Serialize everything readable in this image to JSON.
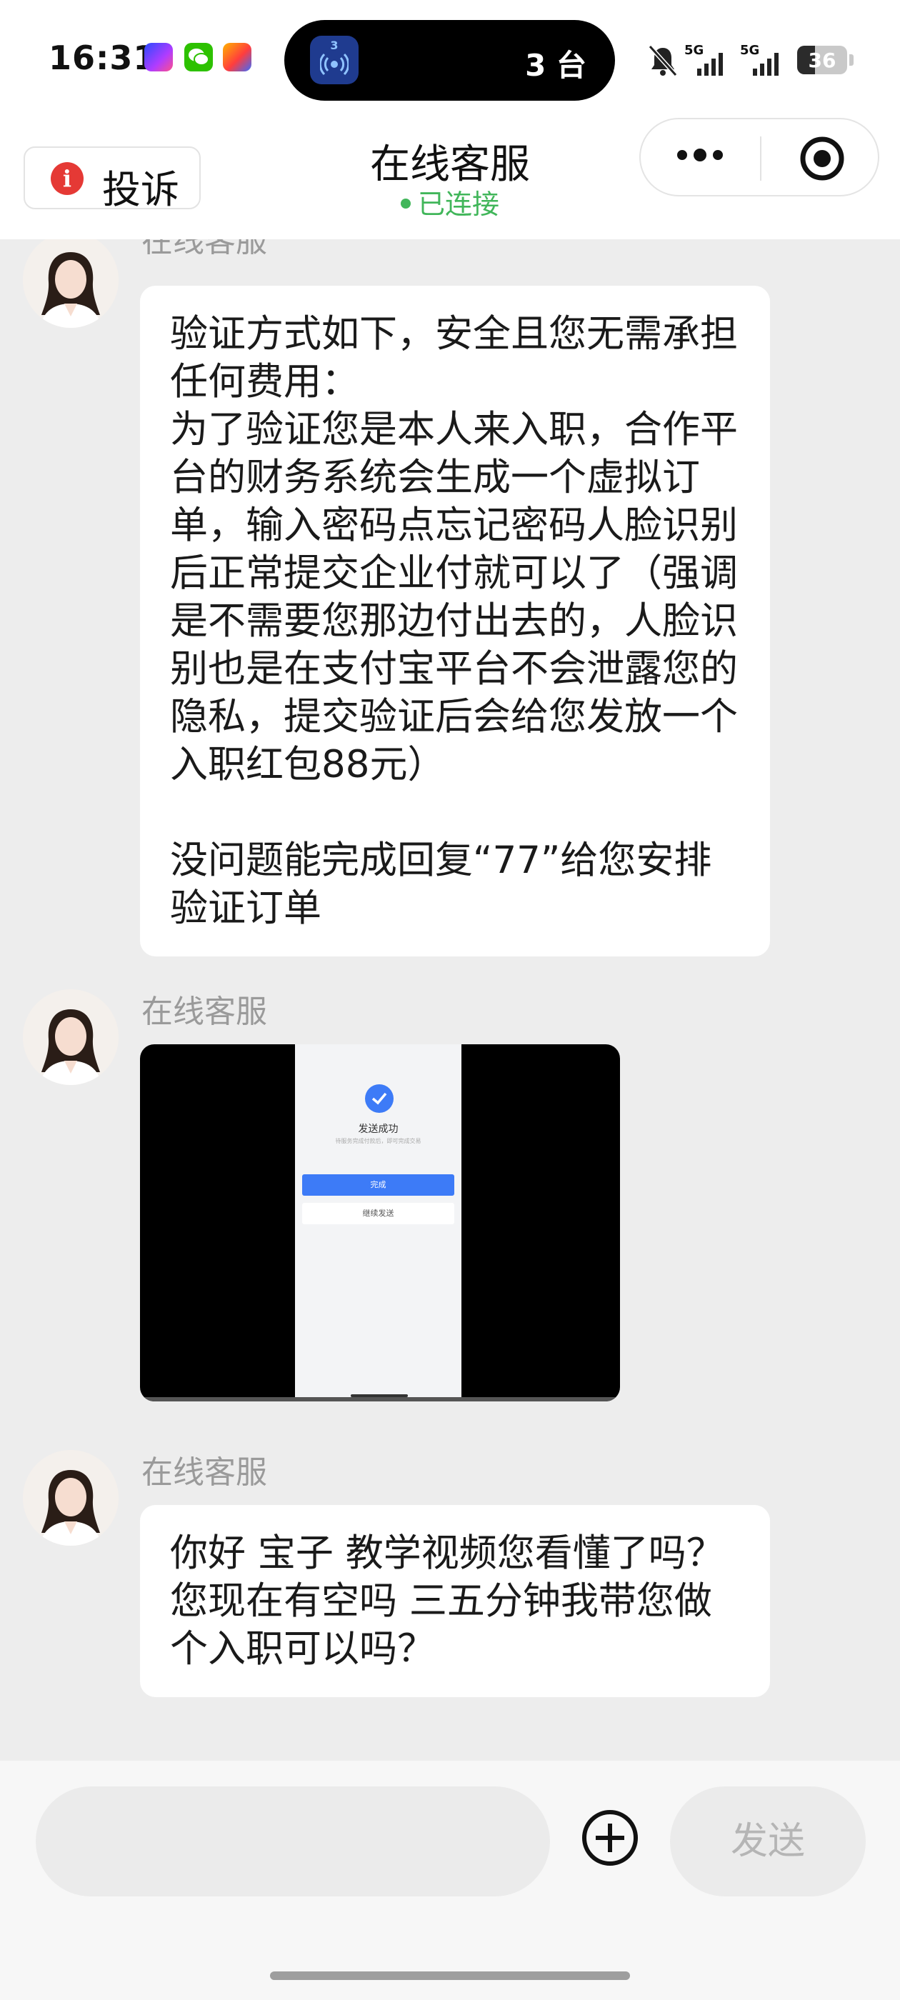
{
  "status_bar": {
    "time": "16:31",
    "island_badge": "3",
    "island_text": "3 台",
    "signal1_label": "5G",
    "signal2_label": "5G",
    "battery_text": "36",
    "battery_level": 0.36,
    "icons": [
      "game-app-icon",
      "wechat-icon",
      "game-app-icon",
      "bell-muted-icon",
      "signal-icon",
      "signal-icon",
      "battery-icon"
    ]
  },
  "header": {
    "complaint_label": "投诉",
    "title": "在线客服",
    "connection_status": "已连接",
    "status_color": "#41b65a",
    "alert_color": "#e53935"
  },
  "messages": [
    {
      "sender": "在线客服",
      "type": "text",
      "paragraphs": [
        "验证方式如下，安全且您无需承担任何费用：",
        "为了验证您是本人来入职，合作平台的财务系统会生成一个虚拟订单，输入密码点忘记密码人脸识别后正常提交企业付就可以了（强调是不需要您那边付出去的，人脸识别也是在支付宝平台不会泄露您的隐私，提交验证后会给您发放一个入职红包88元）",
        "",
        "没问题能完成回复“77”给您安排验证订单"
      ]
    },
    {
      "sender": "在线客服",
      "type": "video",
      "video": {
        "title": "发送成功",
        "subtitle": "待服务完成付款后，即可完成交易",
        "primary_button": "完成",
        "secondary_button": "继续发送"
      }
    },
    {
      "sender": "在线客服",
      "type": "text",
      "paragraphs": [
        "你好 宝子 教学视频您看懂了吗？您现在有空吗 三五分钟我带您做个入职可以吗？"
      ]
    }
  ],
  "input_bar": {
    "input_value": "",
    "send_label": "发送"
  }
}
